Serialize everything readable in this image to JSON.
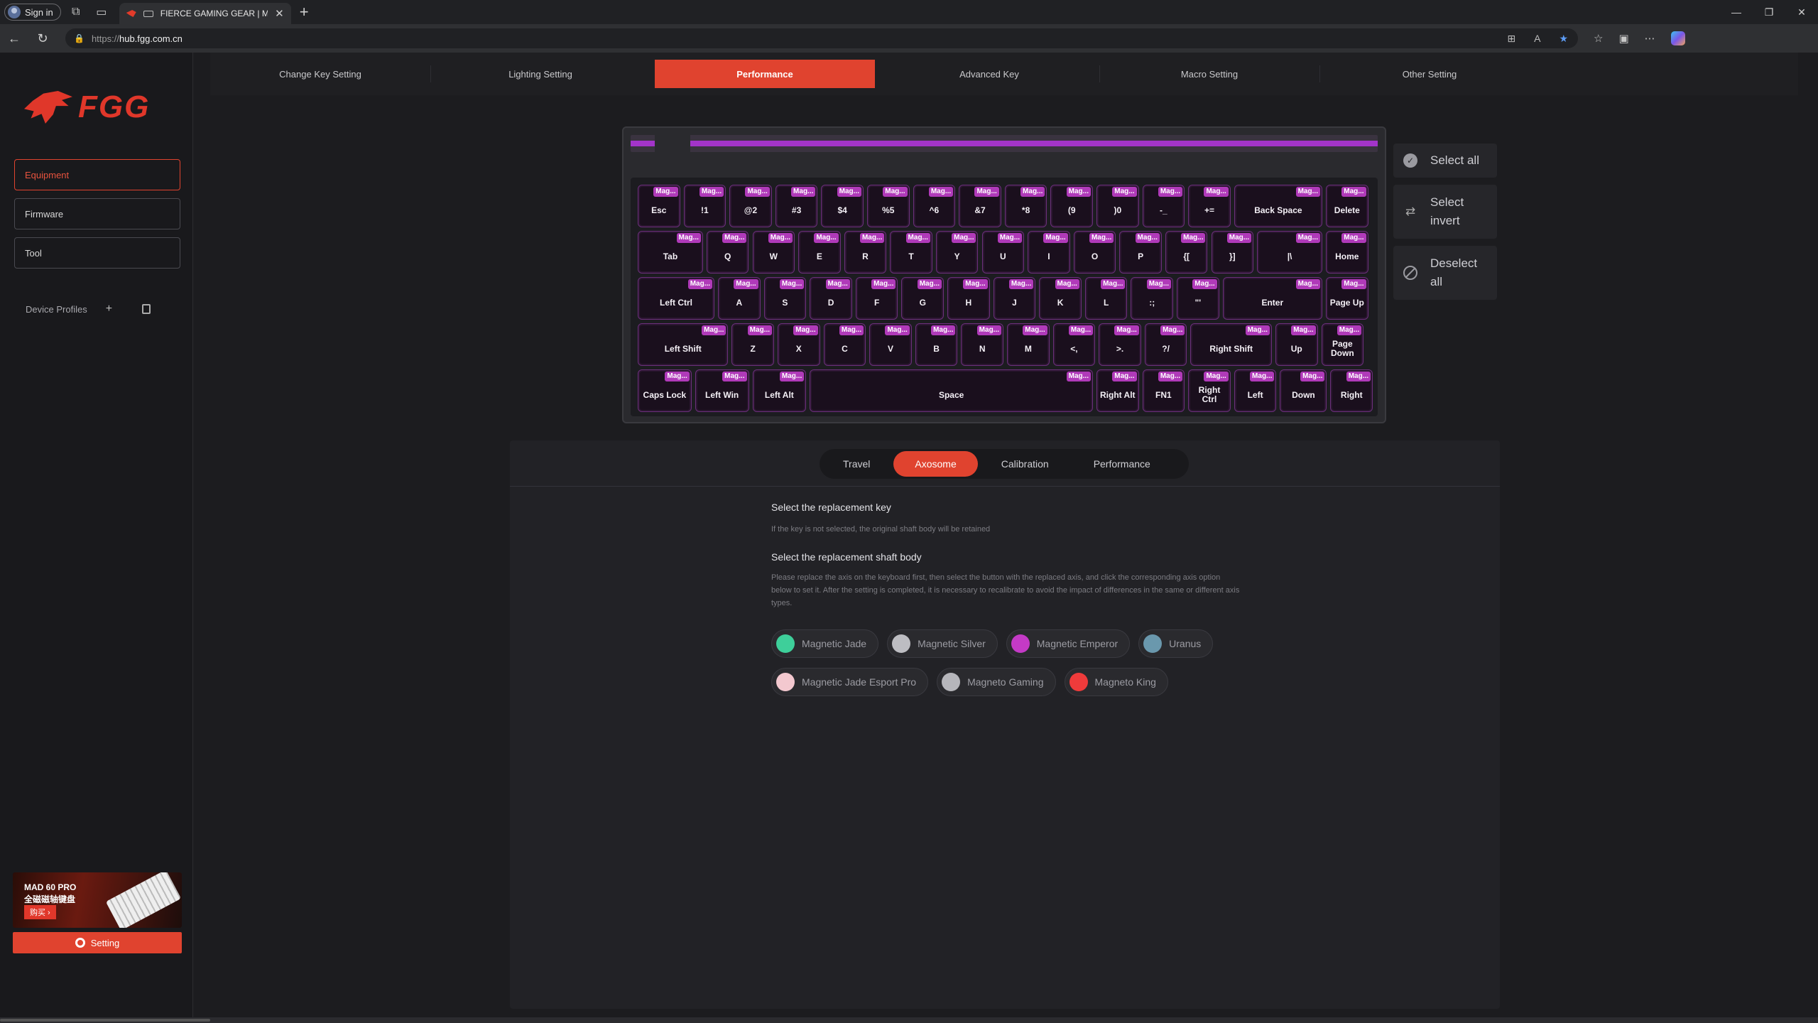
{
  "browser": {
    "sign_in": "Sign in",
    "tab_title": "FIERCE GAMING GEAR | MAD",
    "url_prefix": "https://",
    "url_host": "hub.fgg.com.cn"
  },
  "sidebar": {
    "logo_text": "FGG",
    "items": [
      {
        "label": "Equipment",
        "active": true
      },
      {
        "label": "Firmware",
        "active": false
      },
      {
        "label": "Tool",
        "active": false
      }
    ],
    "profiles_label": "Device Profiles",
    "ad": {
      "line1": "MAD 60 PRO",
      "line2": "全磁磁轴键盘",
      "buy": "购买 ›"
    },
    "setting_label": "Setting"
  },
  "topnav": [
    {
      "label": "Change Key Setting",
      "active": false
    },
    {
      "label": "Lighting Setting",
      "active": false
    },
    {
      "label": "Performance",
      "active": true
    },
    {
      "label": "Advanced Key",
      "active": false
    },
    {
      "label": "Macro Setting",
      "active": false
    },
    {
      "label": "Other Setting",
      "active": false
    }
  ],
  "keyboard": {
    "badge": "Mag...",
    "rows": [
      [
        "Esc",
        "!1",
        "@2",
        "#3",
        "$4",
        "%5",
        "^6",
        "&7",
        "*8",
        "(9",
        ")0",
        "-_",
        "+=",
        "Back Space",
        "Delete"
      ],
      [
        "Tab",
        "Q",
        "W",
        "E",
        "R",
        "T",
        "Y",
        "U",
        "I",
        "O",
        "P",
        "{[",
        "}]",
        "|\\",
        "Home"
      ],
      [
        "Left Ctrl",
        "A",
        "S",
        "D",
        "F",
        "G",
        "H",
        "J",
        "K",
        "L",
        ":;",
        "\"'",
        "Enter",
        "Page Up"
      ],
      [
        "Left Shift",
        "Z",
        "X",
        "C",
        "V",
        "B",
        "N",
        "M",
        "<,",
        ">.",
        "?/",
        "Right Shift",
        "Up",
        "Page Down"
      ],
      [
        "Caps Lock",
        "Left Win",
        "Left Alt",
        "Space",
        "Right Alt",
        "FN1",
        "Right Ctrl",
        "Left",
        "Down",
        "Right"
      ]
    ]
  },
  "selection": {
    "select_all": "Select all",
    "select_invert": "Select invert",
    "deselect_all": "Deselect all"
  },
  "subtabs": [
    {
      "label": "Travel",
      "active": false
    },
    {
      "label": "Axosome",
      "active": true
    },
    {
      "label": "Calibration",
      "active": false
    },
    {
      "label": "Performance",
      "active": false
    }
  ],
  "content": {
    "title1": "Select the replacement key",
    "hint1": "If the key is not selected, the original shaft body will be retained",
    "title2": "Select the replacement shaft body",
    "hint2": "Please replace the axis on the keyboard first, then select the button with the replaced axis, and click the corresponding axis option below to set it. After the setting is completed, it is necessary to recalibrate to avoid the impact of differences in the same or different axis types.",
    "switches": [
      {
        "label": "Magnetic Jade",
        "color": "#3ecf9a"
      },
      {
        "label": "Magnetic Silver",
        "color": "#bdbdc2"
      },
      {
        "label": "Magnetic Emperor",
        "color": "#c43ac6"
      },
      {
        "label": "Uranus",
        "color": "#6a98ad"
      },
      {
        "label": "Magnetic Jade Esport Pro",
        "color": "#f3c8cf"
      },
      {
        "label": "Magneto Gaming",
        "color": "#b6b6bb"
      },
      {
        "label": "Magneto King",
        "color": "#ef3b3b"
      }
    ]
  }
}
